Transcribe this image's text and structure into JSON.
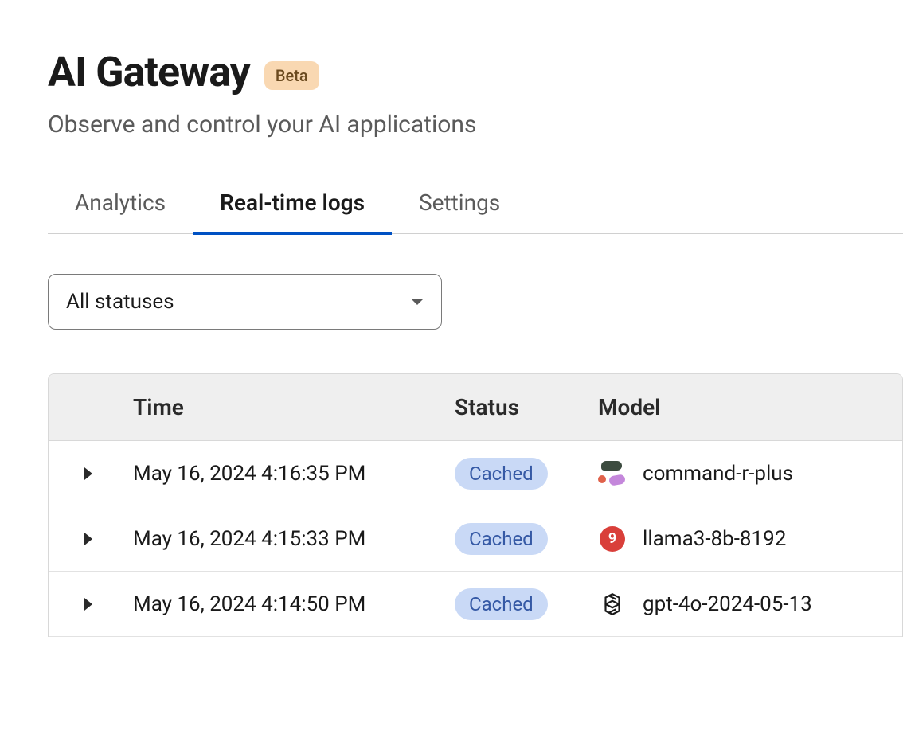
{
  "header": {
    "title": "AI Gateway",
    "badge": "Beta",
    "subtitle": "Observe and control your AI applications"
  },
  "tabs": [
    {
      "label": "Analytics",
      "active": false
    },
    {
      "label": "Real-time logs",
      "active": true
    },
    {
      "label": "Settings",
      "active": false
    }
  ],
  "filter": {
    "status_select": {
      "selected": "All statuses",
      "options": [
        "All statuses"
      ]
    }
  },
  "table": {
    "columns": {
      "time": "Time",
      "status": "Status",
      "model": "Model"
    },
    "rows": [
      {
        "time": "May 16, 2024 4:16:35 PM",
        "status": "Cached",
        "model": "command-r-plus",
        "provider_icon": "cohere-icon"
      },
      {
        "time": "May 16, 2024 4:15:33 PM",
        "status": "Cached",
        "model": "llama3-8b-8192",
        "provider_icon": "groq-icon",
        "provider_icon_glyph": "9"
      },
      {
        "time": "May 16, 2024 4:14:50 PM",
        "status": "Cached",
        "model": "gpt-4o-2024-05-13",
        "provider_icon": "openai-icon"
      }
    ]
  },
  "colors": {
    "tab_active_underline": "#0051c3",
    "badge_bg": "#f9d8b2",
    "status_badge_bg": "#c9d9f6",
    "status_badge_fg": "#3559a5"
  }
}
